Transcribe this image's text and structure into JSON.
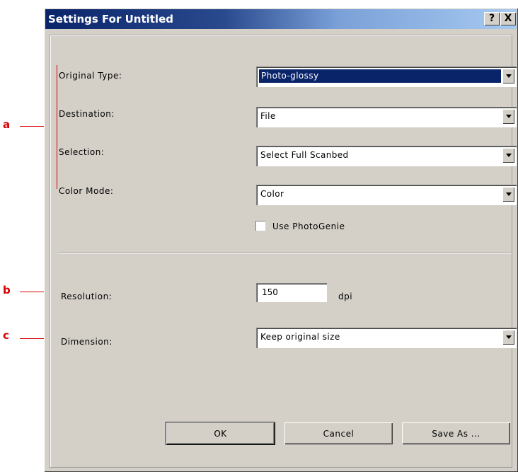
{
  "window": {
    "title": "Settings For Untitled",
    "help_glyph": "?",
    "close_glyph": "X"
  },
  "fields": {
    "original_type": {
      "label": "Original Type:",
      "value": "Photo-glossy"
    },
    "destination": {
      "label": "Destination:",
      "value": "File"
    },
    "selection": {
      "label": "Selection:",
      "value": "Select Full Scanbed"
    },
    "color_mode": {
      "label": "Color Mode:",
      "value": "Color"
    },
    "use_photogenie": {
      "label": "Use PhotoGenie",
      "checked": false
    },
    "resolution": {
      "label": "Resolution:",
      "value": "150",
      "unit": "dpi"
    },
    "dimension": {
      "label": "Dimension:",
      "value": "Keep original size"
    }
  },
  "buttons": {
    "ok": "OK",
    "cancel": "Cancel",
    "save_as": "Save As ..."
  },
  "annotations": {
    "a": "a",
    "b": "b",
    "c": "c"
  },
  "colors": {
    "annotation": "#d40000",
    "titlebar_start": "#0a246a",
    "dialog_face": "#d4d0c8"
  }
}
